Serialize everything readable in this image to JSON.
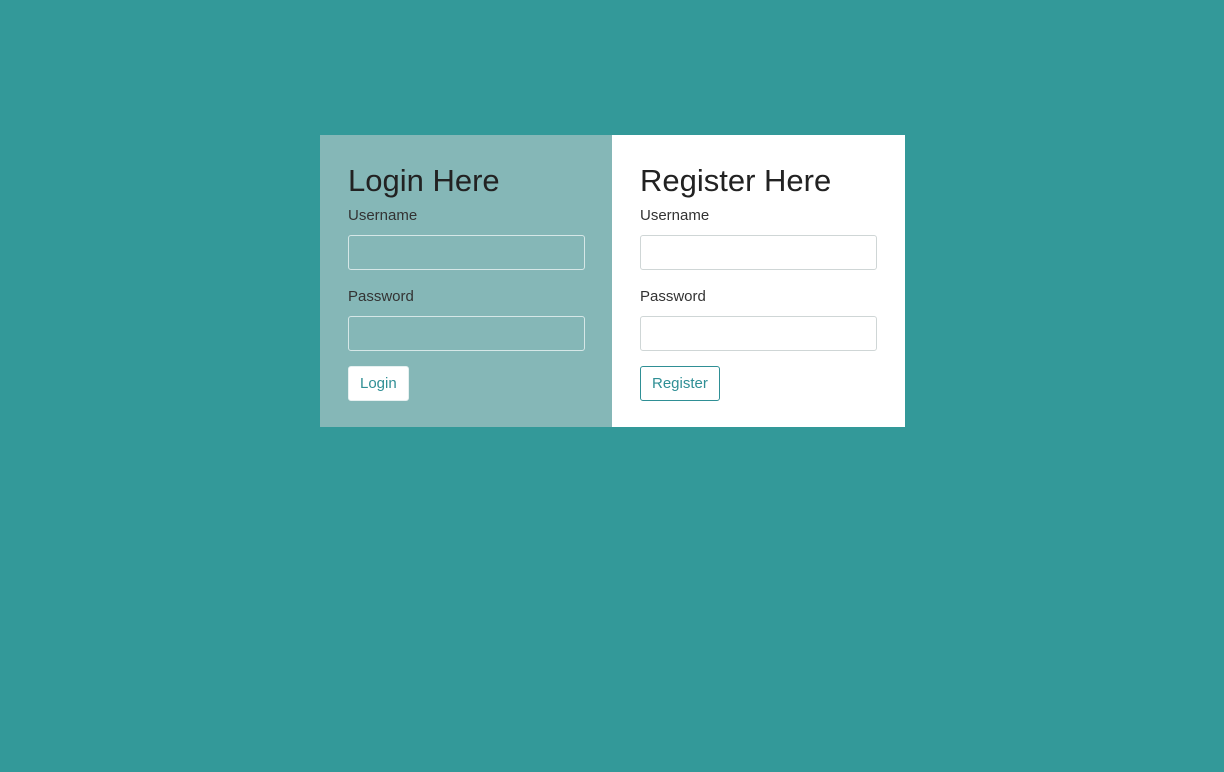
{
  "login": {
    "heading": "Login Here",
    "username_label": "Username",
    "username_value": "",
    "password_label": "Password",
    "password_value": "",
    "button_label": "Login"
  },
  "register": {
    "heading": "Register Here",
    "username_label": "Username",
    "username_value": "",
    "password_label": "Password",
    "password_value": "",
    "button_label": "Register"
  },
  "colors": {
    "page_background": "#339999",
    "login_panel_background": "#85b7b7",
    "register_panel_background": "#ffffff",
    "accent": "#2f8f95"
  }
}
